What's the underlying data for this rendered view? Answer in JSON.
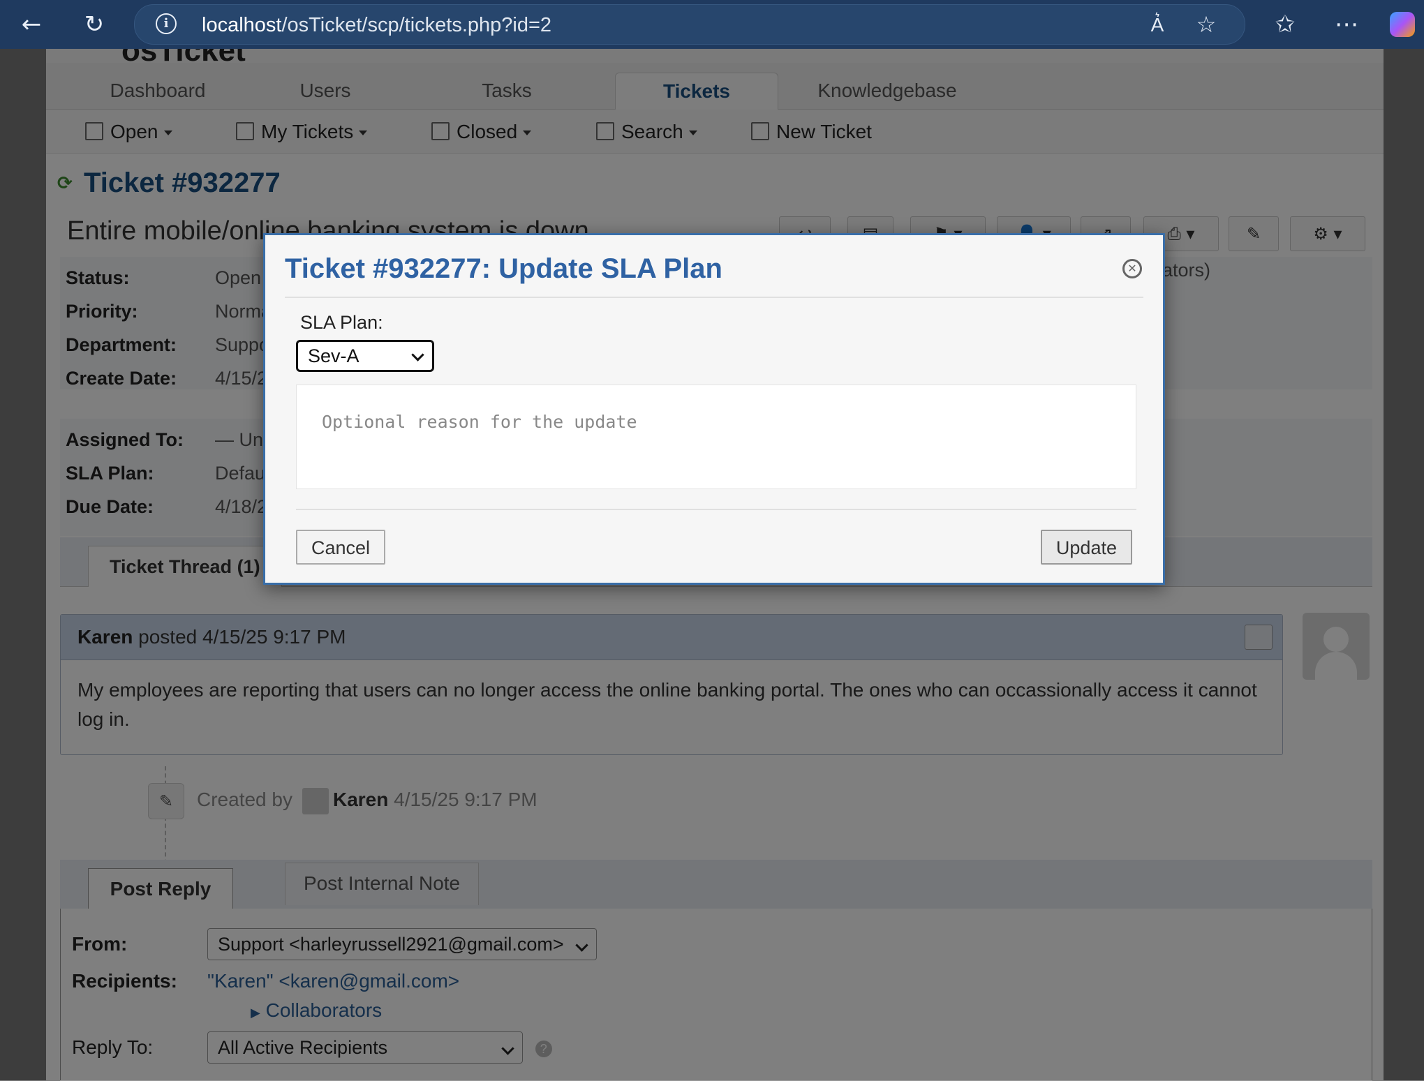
{
  "browser": {
    "url_host": "localhost",
    "url_path": "/osTicket/scp/tickets.php?id=2"
  },
  "logo": "osTicket",
  "nav": {
    "tabs": [
      "Dashboard",
      "Users",
      "Tasks",
      "Tickets",
      "Knowledgebase"
    ],
    "active": "Tickets"
  },
  "subnav": {
    "items": [
      "Open",
      "My Tickets",
      "Closed",
      "Search",
      "New Ticket"
    ]
  },
  "ticket": {
    "title": "Ticket #932277",
    "subject": "Entire mobile/online banking system is down",
    "fields1": [
      {
        "label": "Status:",
        "value": "Open"
      },
      {
        "label": "Priority:",
        "value": "Normal"
      },
      {
        "label": "Department:",
        "value": "Support"
      },
      {
        "label": "Create Date:",
        "value": "4/15/25 9:17 PM"
      }
    ],
    "fields2": [
      {
        "label": "Assigned To:",
        "value": "— Unassigned —"
      },
      {
        "label": "SLA Plan:",
        "value": "Default SLA"
      },
      {
        "label": "Due Date:",
        "value": "4/18/25 9:17 PM"
      }
    ],
    "right_snippet": "rators)"
  },
  "thread": {
    "tab_label": "Ticket Thread (1)",
    "author": "Karen",
    "posted_text": "posted 4/15/25 9:17 PM",
    "body": "My employees are reporting that users can no longer access the online banking portal. The ones who can occassionally access it cannot log in.",
    "event_prefix": "Created by",
    "event_author": "Karen",
    "event_time": "4/15/25 9:17 PM"
  },
  "reply": {
    "tabs": [
      "Post Reply",
      "Post Internal Note"
    ],
    "from_label": "From:",
    "from_value": "Support <harleyrussell2921@gmail.com>",
    "recipients_label": "Recipients:",
    "recipients_value": "\"Karen\" <karen@gmail.com>",
    "collaborators": "Collaborators",
    "reply_to_label": "Reply To:",
    "reply_to_value": "All Active Recipients"
  },
  "modal": {
    "title": "Ticket #932277: Update SLA Plan",
    "sla_label": "SLA Plan:",
    "sla_value": "Sev-A",
    "reason_placeholder": "Optional reason for the update",
    "cancel": "Cancel",
    "update": "Update"
  },
  "colors": {
    "accent": "#2f62a3",
    "browser_bar": "#1f3a5f",
    "modal_border": "#3a6ea8"
  }
}
